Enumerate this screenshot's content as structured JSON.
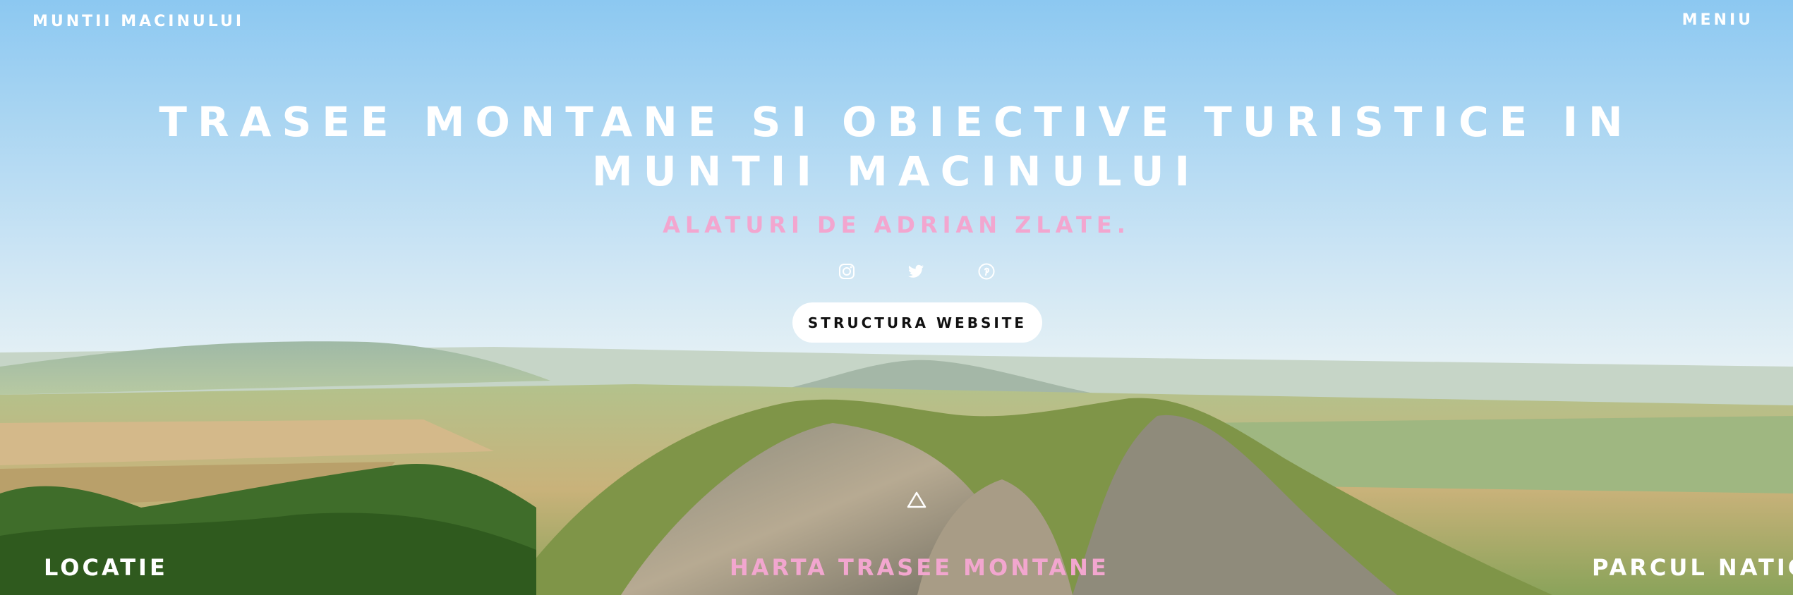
{
  "header": {
    "brand": "MUNTII MACINULUI",
    "menu_label": "MENIU"
  },
  "hero": {
    "title": "TRASEE MONTANE SI OBIECTIVE TURISTICE IN MUNTII MACINULUI",
    "subtitle": "ALATURI DE ADRIAN ZLATE.",
    "cta_label": "STRUCTURA WEBSITE",
    "social_icons": [
      "instagram-icon",
      "twitter-icon",
      "pinterest-icon"
    ]
  },
  "bottom_nav": {
    "items": [
      {
        "label": "LOCATIE"
      },
      {
        "label": "HARTA TRASEE MONTANE"
      },
      {
        "label": "PARCUL NATIC"
      }
    ]
  },
  "colors": {
    "accent_pink": "#f2a6cf",
    "text_white": "#ffffff"
  }
}
